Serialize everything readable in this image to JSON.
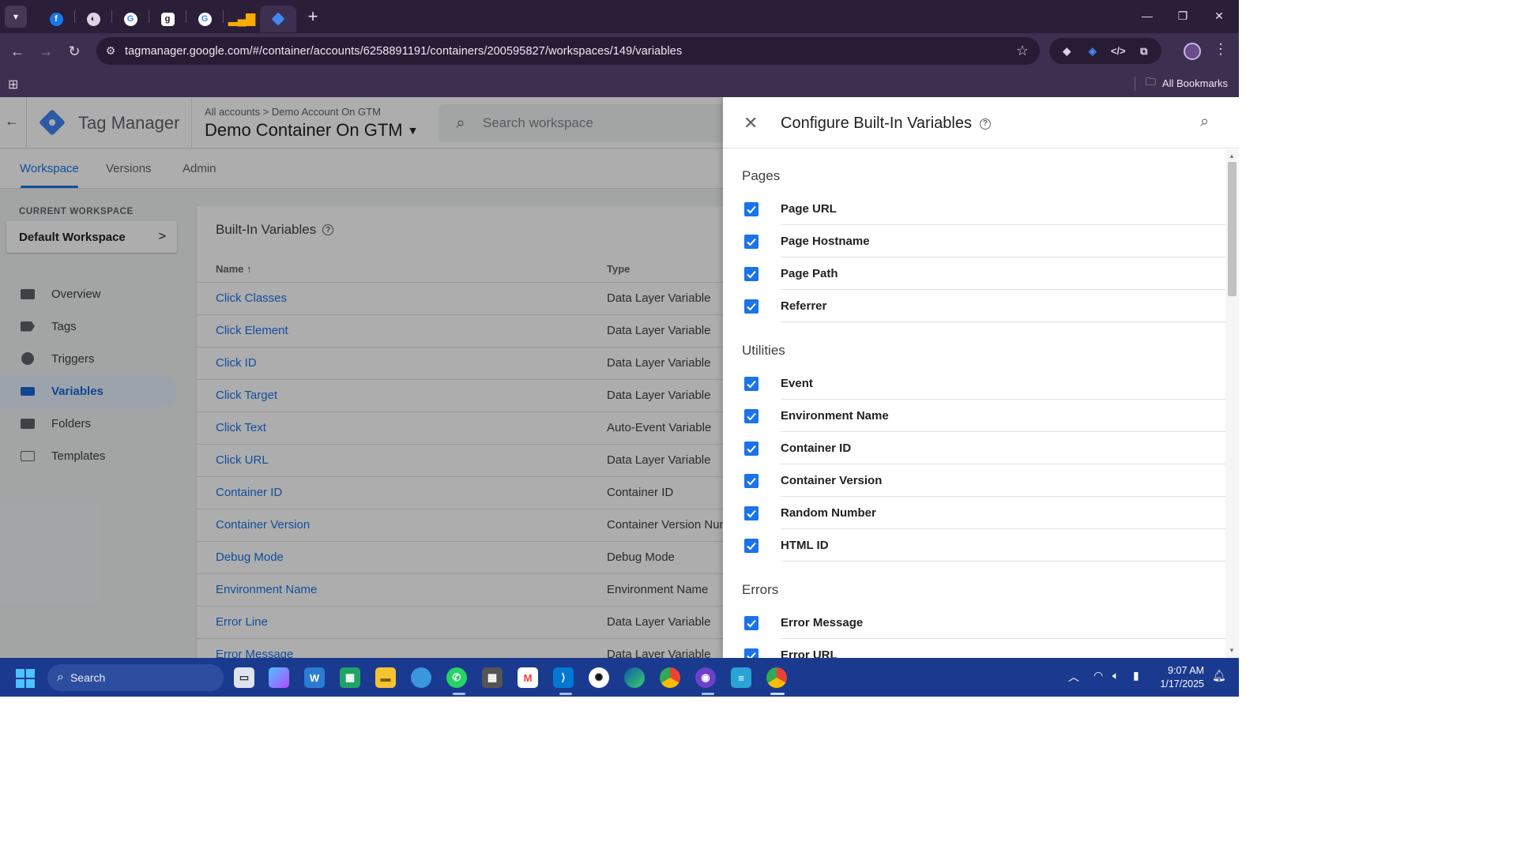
{
  "browser": {
    "url": "tagmanager.google.com/#/container/accounts/6258891191/containers/200595827/workspaces/149/variables",
    "all_bookmarks": "All Bookmarks",
    "tabs": [
      "facebook",
      "web",
      "google",
      "grammarly",
      "google",
      "analytics",
      "tag-manager"
    ]
  },
  "header": {
    "product": "Tag Manager",
    "breadcrumb": "All accounts  >  Demo Account On GTM",
    "container": "Demo Container On GTM",
    "search_placeholder": "Search workspace"
  },
  "nav_tabs": [
    "Workspace",
    "Versions",
    "Admin"
  ],
  "sidebar": {
    "current_label": "CURRENT WORKSPACE",
    "workspace": "Default Workspace",
    "items": [
      "Overview",
      "Tags",
      "Triggers",
      "Variables",
      "Folders",
      "Templates"
    ],
    "active": "Variables"
  },
  "builtins_card": {
    "title": "Built-In Variables",
    "col_name": "Name",
    "col_type": "Type",
    "rows": [
      {
        "name": "Click Classes",
        "type": "Data Layer Variable"
      },
      {
        "name": "Click Element",
        "type": "Data Layer Variable"
      },
      {
        "name": "Click ID",
        "type": "Data Layer Variable"
      },
      {
        "name": "Click Target",
        "type": "Data Layer Variable"
      },
      {
        "name": "Click Text",
        "type": "Auto-Event Variable"
      },
      {
        "name": "Click URL",
        "type": "Data Layer Variable"
      },
      {
        "name": "Container ID",
        "type": "Container ID"
      },
      {
        "name": "Container Version",
        "type": "Container Version Num"
      },
      {
        "name": "Debug Mode",
        "type": "Debug Mode"
      },
      {
        "name": "Environment Name",
        "type": "Environment Name"
      },
      {
        "name": "Error Line",
        "type": "Data Layer Variable"
      },
      {
        "name": "Error Message",
        "type": "Data Layer Variable"
      }
    ]
  },
  "panel": {
    "title": "Configure Built-In Variables",
    "sections": [
      {
        "name": "Pages",
        "items": [
          "Page URL",
          "Page Hostname",
          "Page Path",
          "Referrer"
        ]
      },
      {
        "name": "Utilities",
        "items": [
          "Event",
          "Environment Name",
          "Container ID",
          "Container Version",
          "Random Number",
          "HTML ID"
        ]
      },
      {
        "name": "Errors",
        "items": [
          "Error Message",
          "Error URL"
        ]
      }
    ]
  },
  "taskbar": {
    "search": "Search",
    "time": "9:07 AM",
    "date": "1/17/2025"
  },
  "colors": {
    "accent": "#1a73e8",
    "chrome": "#3d2f4f",
    "taskbar": "#1a3a8f"
  }
}
